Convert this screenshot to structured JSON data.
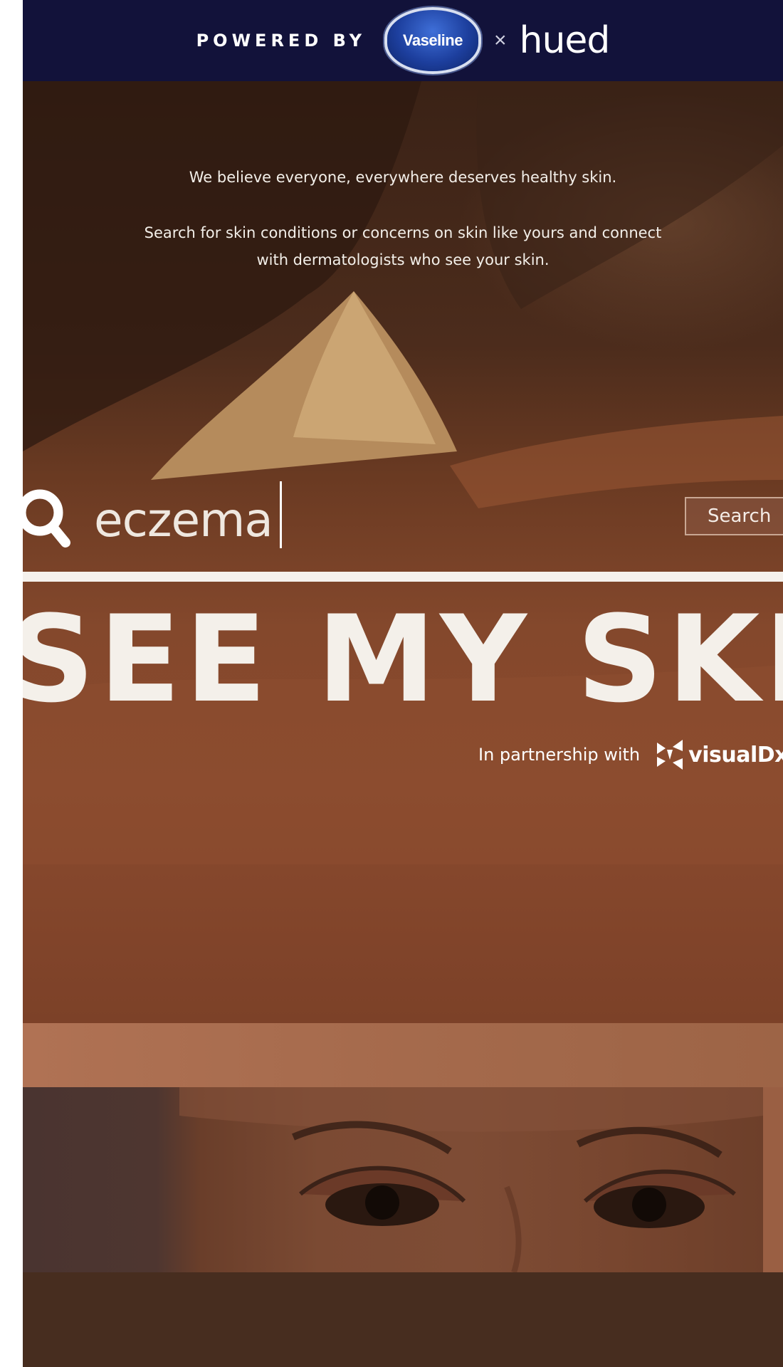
{
  "brand_bar": {
    "powered_by": "POWERED BY",
    "vaseline_logo": "Vaseline",
    "times": "×",
    "hued_logo": "hued"
  },
  "hero": {
    "tagline": "We believe everyone, everywhere deserves healthy skin.",
    "description_line1": "Search for skin conditions or concerns on skin like yours and connect",
    "description_line2": "with dermatologists who see your skin."
  },
  "search": {
    "value": "eczema",
    "button_label": "Search",
    "icon": "search-icon"
  },
  "title": "SEE MY SKIN",
  "partnership": {
    "text": "In partnership with",
    "partner_logo": "visualDx"
  },
  "colors": {
    "brand_bar": "#12123a",
    "band": "#b07254",
    "bottom": "#472d1f",
    "title": "#f4f0ea"
  }
}
